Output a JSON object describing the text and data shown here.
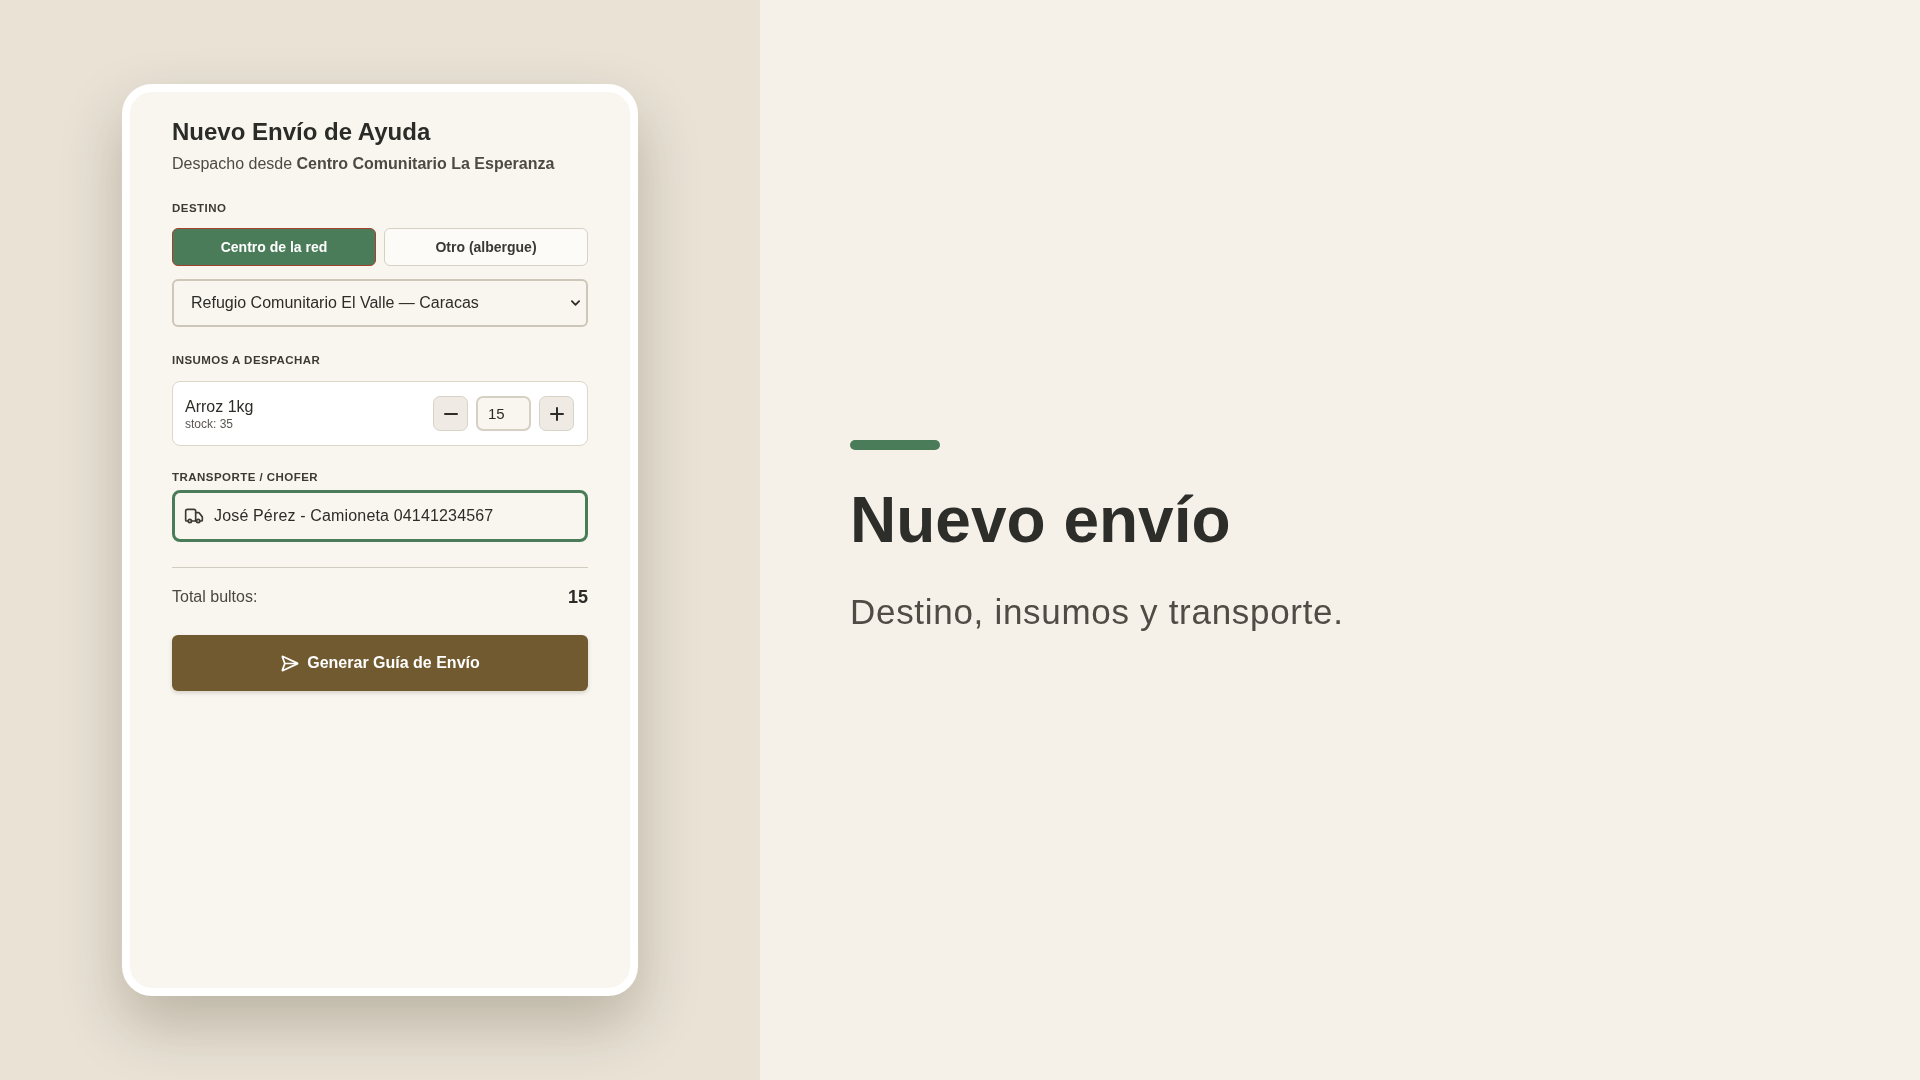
{
  "form": {
    "title": "Nuevo Envío de Ayuda",
    "subtitle": "Despacho desde **Centro Comunitario La Esperanza**",
    "destination": {
      "label": "DESTINO",
      "options": [
        {
          "label": "Centro de la red",
          "selected": true
        },
        {
          "label": "Otro (albergue)",
          "selected": false
        }
      ],
      "select": {
        "value": "Refugio Comunitario El Valle — Caracas"
      }
    },
    "supplies": {
      "label": "INSUMOS A DESPACHAR",
      "items": [
        {
          "name": "Arroz 1kg",
          "stock": "stock: 35",
          "quantity": "15"
        }
      ]
    },
    "transport": {
      "label": "TRANSPORTE / CHOFER",
      "value": "José Pérez - Camioneta 04141234567",
      "focused": true
    },
    "total": {
      "label": "Total bultos:",
      "value": "15"
    },
    "submit": {
      "label": "Generar Guía de Envío"
    }
  },
  "hero": {
    "title": "Nuevo envío",
    "subtitle": "Destino, insumos y transporte."
  }
}
